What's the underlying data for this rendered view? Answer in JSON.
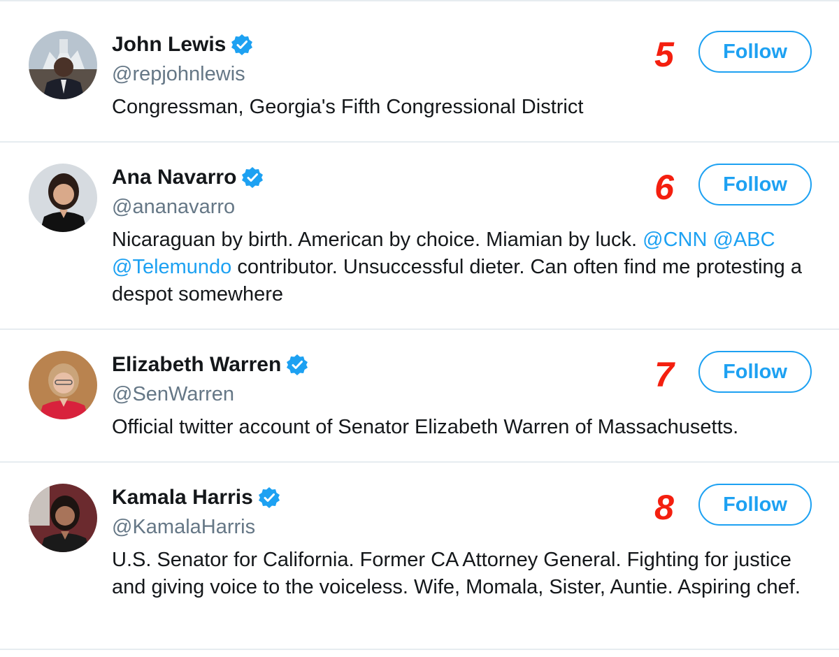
{
  "accounts": [
    {
      "name": "John Lewis",
      "handle": "@repjohnlewis",
      "bio_parts": [
        {
          "text": "Congressman, Georgia's Fifth Congressional District",
          "mention": false
        }
      ],
      "rank": "5",
      "follow_label": "Follow",
      "verified": true
    },
    {
      "name": "Ana Navarro",
      "handle": "@ananavarro",
      "bio_parts": [
        {
          "text": "Nicaraguan by birth. American by choice. Miamian by luck. ",
          "mention": false
        },
        {
          "text": "@CNN",
          "mention": true
        },
        {
          "text": " ",
          "mention": false
        },
        {
          "text": "@ABC",
          "mention": true
        },
        {
          "text": " ",
          "mention": false
        },
        {
          "text": "@Telemundo",
          "mention": true
        },
        {
          "text": " contributor. Unsuccessful dieter. Can often find me protesting a despot somewhere",
          "mention": false
        }
      ],
      "rank": "6",
      "follow_label": "Follow",
      "verified": true
    },
    {
      "name": "Elizabeth Warren",
      "handle": "@SenWarren",
      "bio_parts": [
        {
          "text": "Official twitter account of Senator Elizabeth Warren of Massachusetts.",
          "mention": false
        }
      ],
      "rank": "7",
      "follow_label": "Follow",
      "verified": true
    },
    {
      "name": "Kamala Harris",
      "handle": "@KamalaHarris",
      "bio_parts": [
        {
          "text": "U.S. Senator for California. Former CA Attorney General. Fighting for justice and giving voice to the voiceless. Wife, Momala, Sister, Auntie. Aspiring chef.",
          "mention": false
        }
      ],
      "rank": "8",
      "follow_label": "Follow",
      "verified": true
    }
  ],
  "colors": {
    "accent": "#1da1f2",
    "rank": "#f41f0f",
    "text": "#14171a",
    "secondary": "#657786",
    "divider": "#e6ecf0"
  }
}
